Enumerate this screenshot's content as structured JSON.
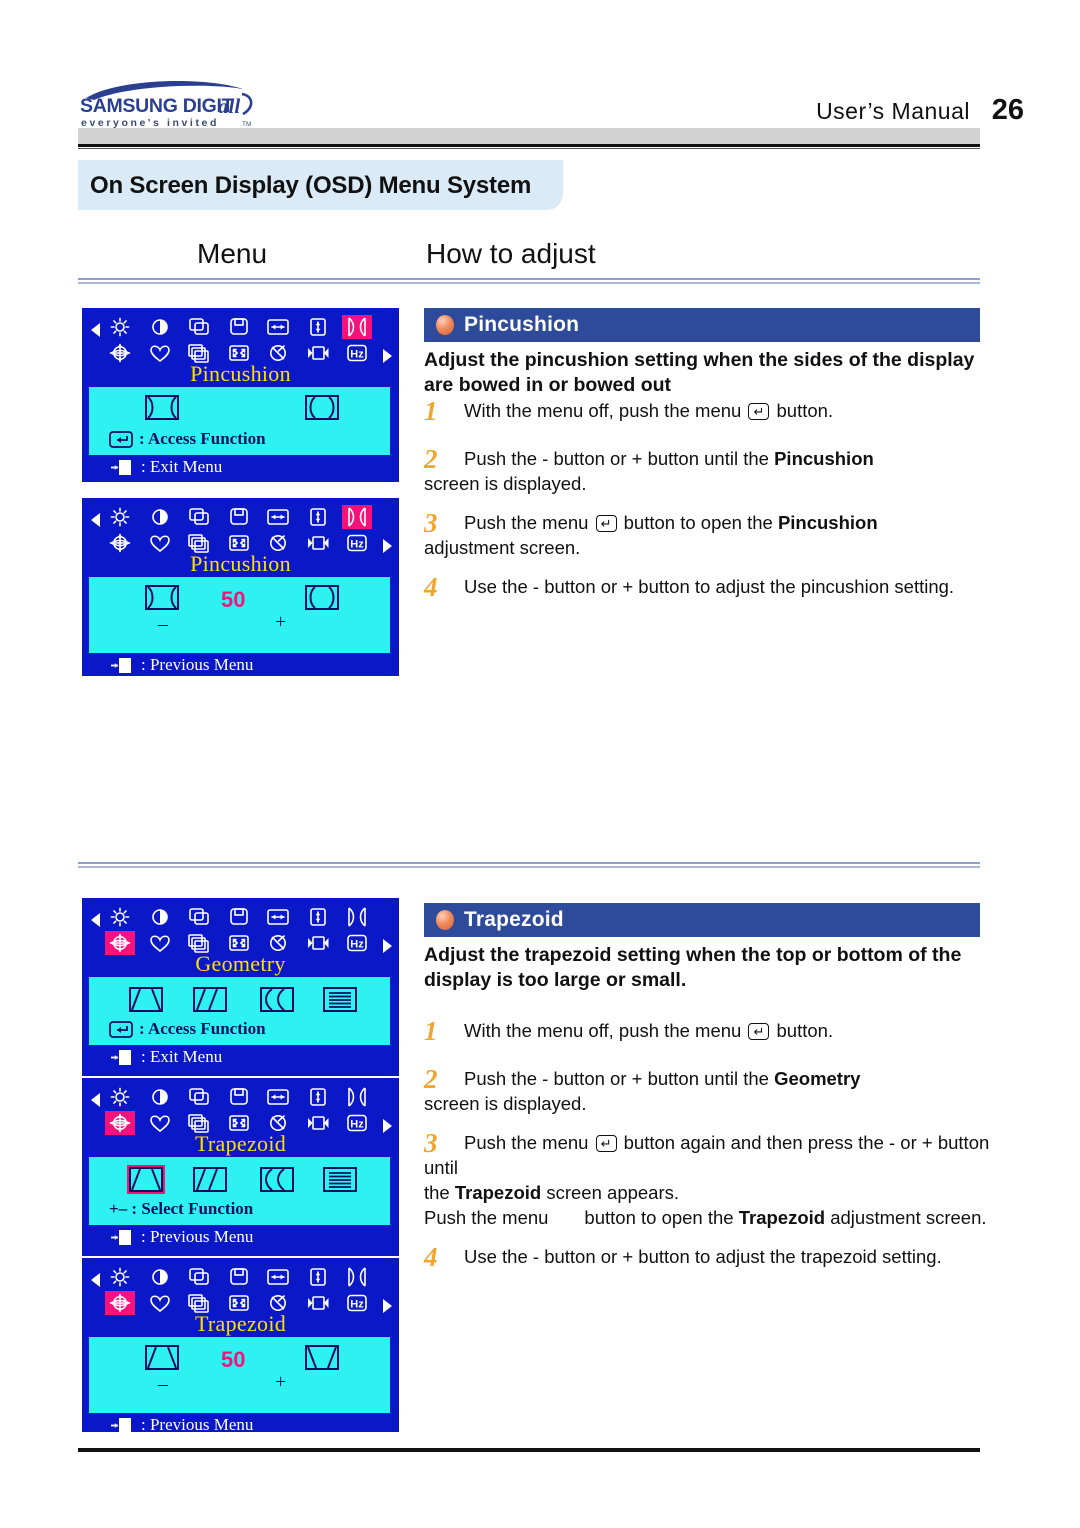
{
  "header": {
    "logo_main": "SAMSUNG DIGITall",
    "logo_tagline": "everyone's invited",
    "logo_tm": "TM",
    "manual_label": "User’s Manual",
    "page_number": "26"
  },
  "osd_tab_title": "On Screen Display (OSD) Menu System",
  "columns": {
    "menu": "Menu",
    "how_to_adjust": "How to adjust"
  },
  "sections": [
    {
      "id": "pincushion",
      "header": "Pincushion",
      "lead": "Adjust the pincushion setting when the sides of the display are bowed in or bowed out",
      "steps": [
        {
          "num": "1",
          "html": "With the menu off, push the menu <span class=\"kbd\">↵</span> button."
        },
        {
          "num": "2",
          "html": "Push the  - button or  + button until the <b>Pincushion</b><br>screen is displayed."
        },
        {
          "num": "3",
          "html": "Push the menu <span class=\"kbd\">↵</span> button to open the <b>Pincushion</b><br>adjustment screen."
        },
        {
          "num": "4",
          "html": "Use the  - button or  + button to adjust the pincushion setting."
        }
      ]
    },
    {
      "id": "trapezoid",
      "header": "Trapezoid",
      "lead": "Adjust the trapezoid setting when the top or bottom of the display is too large or small.",
      "steps": [
        {
          "num": "1",
          "html": "With the menu off, push the menu <span class=\"kbd\">↵</span> button."
        },
        {
          "num": "2",
          "html": "Push the - button or + button until the <b>Geometry</b><br>screen is displayed."
        },
        {
          "num": "3",
          "html": "Push the menu <span class=\"kbd\">↵</span> button again and then press the - or + button until<br>the <b>Trapezoid</b>  screen appears.<br>Push the menu &nbsp;&nbsp;&nbsp;&nbsp;&nbsp; button to open the  <b>Trapezoid</b> adjustment screen."
        },
        {
          "num": "4",
          "html": "Use the  - button or  + button to adjust the trapezoid setting."
        }
      ]
    }
  ],
  "osd_panels": [
    {
      "id": "pincushion-menu",
      "title": "Pincushion",
      "highlight_icon": "pincushion",
      "sub_icons": [
        "pincushion-in",
        "pincushion-out"
      ],
      "value": null,
      "footlines": [
        {
          "glyph": "enter",
          "text": ": Access Function",
          "style": "dark"
        },
        {
          "glyph": "exit",
          "text": ": Exit Menu",
          "style": "light"
        }
      ]
    },
    {
      "id": "pincushion-adjust",
      "title": "Pincushion",
      "highlight_icon": "pincushion",
      "sub_icons": [
        "pincushion-in",
        "pincushion-out"
      ],
      "value": "50",
      "minus": "–",
      "plus": "+",
      "footlines": [
        {
          "glyph": "exit",
          "text": ": Previous Menu",
          "style": "light"
        }
      ]
    },
    {
      "id": "geometry-menu",
      "title": "Geometry",
      "highlight_icon": "geometry",
      "sub_icons": [
        "trapezoid",
        "parallelogram",
        "pinbalance",
        "linearity"
      ],
      "value": null,
      "footlines": [
        {
          "glyph": "enter",
          "text": ": Access Function",
          "style": "dark"
        },
        {
          "glyph": "exit",
          "text": ": Exit Menu",
          "style": "light"
        }
      ]
    },
    {
      "id": "trapezoid-menu",
      "title": "Trapezoid",
      "highlight_icon": "geometry",
      "sub_icons": [
        "trapezoid",
        "parallelogram",
        "pinbalance",
        "linearity"
      ],
      "selected_sub_icon": "trapezoid",
      "value": null,
      "footlines": [
        {
          "glyph": "plusminus",
          "text": "+– : Select Function",
          "style": "dark"
        },
        {
          "glyph": "exit",
          "text": ": Previous Menu",
          "style": "light"
        }
      ]
    },
    {
      "id": "trapezoid-adjust",
      "title": "Trapezoid",
      "highlight_icon": "geometry",
      "sub_icons": [
        "trapezoid-narrow-top",
        "trapezoid-narrow-bottom"
      ],
      "value": "50",
      "minus": "–",
      "plus": "+",
      "footlines": [
        {
          "glyph": "exit",
          "text": ": Previous Menu",
          "style": "light"
        }
      ]
    }
  ],
  "osd_toolbar_icons": [
    "brightness-icon",
    "contrast-icon",
    "h-position-icon",
    "v-position-icon",
    "h-size-icon",
    "v-size-icon",
    "pincushion-icon",
    "geometry-icon",
    "color-icon",
    "recall-icon",
    "zoom-icon",
    "degauss-icon",
    "osd-position-icon",
    "frequency-hz-icon"
  ],
  "colors": {
    "osd_blue": "#0a18c8",
    "osd_cyan": "#2ef2f2",
    "osd_yellow": "#ffe000",
    "osd_magenta": "#f5127b",
    "section_bar": "#2e4b9b",
    "tab_bg": "#dbeaf7",
    "step_number": "#f0a52e",
    "logo_blue": "#2b3f91"
  }
}
